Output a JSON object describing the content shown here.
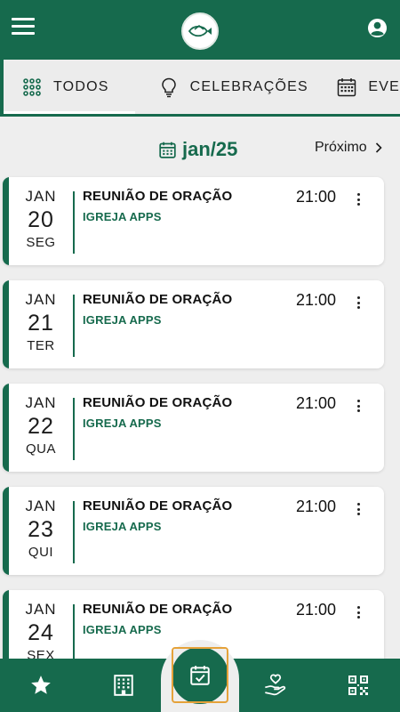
{
  "tabs": [
    {
      "label": "TODOS",
      "icon": "grid-dots-icon"
    },
    {
      "label": "CELEBRAÇÕES",
      "icon": "lightbulb-icon"
    },
    {
      "label": "EVE",
      "icon": "calendar-grid-icon"
    }
  ],
  "month_label": "jan/25",
  "next_label": "Próximo",
  "events": [
    {
      "month": "JAN",
      "day": "20",
      "weekday": "SEG",
      "title": "REUNIÃO DE ORAÇÃO",
      "org": "IGREJA APPS",
      "time": "21:00"
    },
    {
      "month": "JAN",
      "day": "21",
      "weekday": "TER",
      "title": "REUNIÃO DE ORAÇÃO",
      "org": "IGREJA APPS",
      "time": "21:00"
    },
    {
      "month": "JAN",
      "day": "22",
      "weekday": "QUA",
      "title": "REUNIÃO DE ORAÇÃO",
      "org": "IGREJA APPS",
      "time": "21:00"
    },
    {
      "month": "JAN",
      "day": "23",
      "weekday": "QUI",
      "title": "REUNIÃO DE ORAÇÃO",
      "org": "IGREJA APPS",
      "time": "21:00"
    },
    {
      "month": "JAN",
      "day": "24",
      "weekday": "SEX",
      "title": "REUNIÃO DE ORAÇÃO",
      "org": "IGREJA APPS",
      "time": "21:00"
    }
  ],
  "bottom_nav": [
    {
      "icon": "star-icon"
    },
    {
      "icon": "building-icon"
    },
    {
      "icon": "calendar-check-icon",
      "active": true
    },
    {
      "icon": "hand-heart-icon"
    },
    {
      "icon": "qr-code-icon"
    }
  ],
  "colors": {
    "primary": "#166a4d",
    "background": "#eeeeee",
    "focus_outline": "#e5a23a"
  }
}
